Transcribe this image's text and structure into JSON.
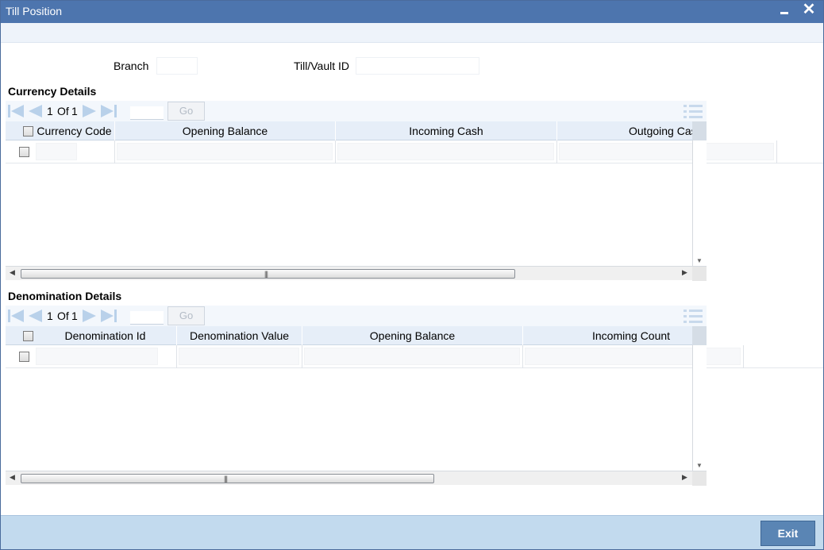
{
  "window": {
    "title": "Till Position"
  },
  "form": {
    "branch_label": "Branch",
    "branch_value": "",
    "till_label": "Till/Vault ID",
    "till_value": ""
  },
  "currency": {
    "title": "Currency Details",
    "pager": {
      "current": "1",
      "of_label": "Of",
      "total": "1",
      "go_label": "Go",
      "page_input": ""
    },
    "columns": [
      "Currency Code",
      "Opening Balance",
      "Incoming Cash",
      "Outgoing Cas"
    ]
  },
  "denomination": {
    "title": "Denomination Details",
    "pager": {
      "current": "1",
      "of_label": "Of",
      "total": "1",
      "go_label": "Go",
      "page_input": ""
    },
    "columns": [
      "Denomination Id",
      "Denomination Value",
      "Opening Balance",
      "Incoming Count"
    ]
  },
  "footer": {
    "exit_label": "Exit"
  },
  "colors": {
    "titlebar": "#4d75ae",
    "footer": "#c2daee",
    "exit_button": "#5a85b4",
    "header_row": "#e6eef8"
  },
  "icons": [
    "minimize-icon",
    "close-icon",
    "first-page-icon",
    "previous-page-icon",
    "next-page-icon",
    "last-page-icon",
    "list-view-icon",
    "scroll-grip-icon"
  ]
}
